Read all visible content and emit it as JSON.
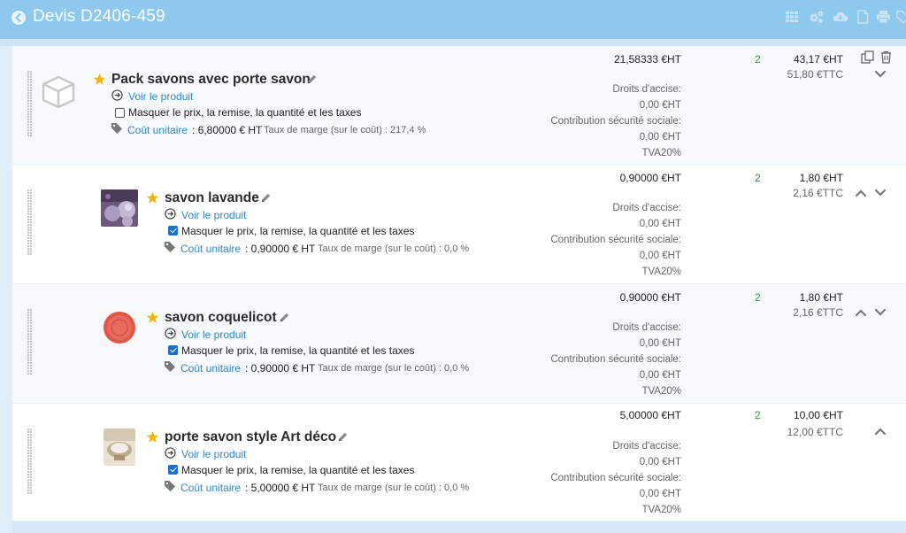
{
  "header": {
    "title": "Devis D2406-459"
  },
  "colors": {
    "header": "#8ec8ed",
    "link": "#2f86c9",
    "qty": "#3a8a3a",
    "star": "#f4b400"
  },
  "lines": [
    {
      "name": "Pack savons avec porte savon",
      "view_link": "Voir le produit",
      "hide_label": "Masquer le prix, la remise, la quantité et les taxes",
      "hide_checked": false,
      "cost_label": "Coût unitaire",
      "cost_value": ": 6,80000 € HT",
      "margin": "Taux de marge (sur le coût) : 217,4 %",
      "unit_price": "21,58333 €HT",
      "excise_label": "Droits d'accise:",
      "excise_value": "0,00 €HT",
      "social_label": "Contribution sécurité sociale:",
      "social_value": "0,00 €HT",
      "vat": "TVA20%",
      "qty": "2",
      "total_ht": "43,17 €HT",
      "total_ttc": "51,80 €TTC",
      "thumb": "box-icon"
    },
    {
      "name": "savon lavande",
      "view_link": "Voir le produit",
      "hide_label": "Masquer le prix, la remise, la quantité et les taxes",
      "hide_checked": true,
      "cost_label": "Coût unitaire",
      "cost_value": ": 0,90000 € HT",
      "margin": "Taux de marge (sur le coût) : 0,0 %",
      "unit_price": "0,90000 €HT",
      "excise_label": "Droits d'accise:",
      "excise_value": "0,00 €HT",
      "social_label": "Contribution sécurité sociale:",
      "social_value": "0,00 €HT",
      "vat": "TVA20%",
      "qty": "2",
      "total_ht": "1,80 €HT",
      "total_ttc": "2,16 €TTC",
      "thumb": "lavender-soap-photo"
    },
    {
      "name": "savon coquelicot",
      "view_link": "Voir le produit",
      "hide_label": "Masquer le prix, la remise, la quantité et les taxes",
      "hide_checked": true,
      "cost_label": "Coût unitaire",
      "cost_value": ": 0,90000 € HT",
      "margin": "Taux de marge (sur le coût) : 0,0 %",
      "unit_price": "0,90000 €HT",
      "excise_label": "Droits d'accise:",
      "excise_value": "0,00 €HT",
      "social_label": "Contribution sécurité sociale:",
      "social_value": "0,00 €HT",
      "vat": "TVA20%",
      "qty": "2",
      "total_ht": "1,80 €HT",
      "total_ttc": "2,16 €TTC",
      "thumb": "poppy-soap-photo"
    },
    {
      "name": "porte savon style Art déco",
      "view_link": "Voir le produit",
      "hide_label": "Masquer le prix, la remise, la quantité et les taxes",
      "hide_checked": true,
      "cost_label": "Coût unitaire",
      "cost_value": ": 5,00000 € HT",
      "margin": "Taux de marge (sur le coût) : 0,0 %",
      "unit_price": "5,00000 €HT",
      "excise_label": "Droits d'accise:",
      "excise_value": "0,00 €HT",
      "social_label": "Contribution sécurité sociale:",
      "social_value": "0,00 €HT",
      "vat": "TVA20%",
      "qty": "2",
      "total_ht": "10,00 €HT",
      "total_ttc": "12,00 €TTC",
      "thumb": "soap-dish-photo"
    }
  ]
}
